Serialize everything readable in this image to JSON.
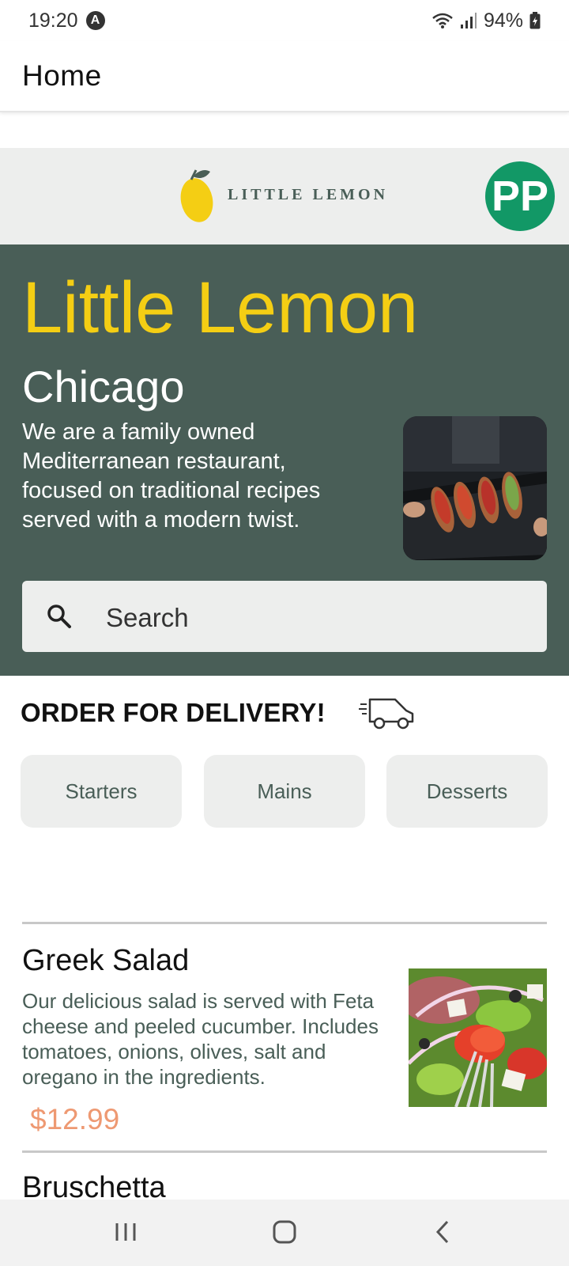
{
  "status_bar": {
    "time": "19:20",
    "app_badge": "A",
    "battery": "94%",
    "icons": [
      "wifi-icon",
      "signal-icon",
      "battery-icon"
    ]
  },
  "app_bar": {
    "title": "Home"
  },
  "brand": {
    "logo_text": "LITTLE LEMON",
    "avatar_initials": "PP",
    "colors": {
      "primary": "#495e57",
      "accent": "#f4ce14",
      "avatar": "#129866",
      "price": "#ee9972"
    }
  },
  "hero": {
    "title": "Little Lemon",
    "subtitle": "Chicago",
    "description": "We are a family owned Mediterranean restaurant, focused on traditional recipes served with a modern twist."
  },
  "search": {
    "placeholder": "Search"
  },
  "delivery": {
    "title": "ORDER FOR DELIVERY!",
    "categories": [
      "Starters",
      "Mains",
      "Desserts"
    ]
  },
  "menu": {
    "items": [
      {
        "name": "Greek Salad",
        "description": " Our delicious salad is served with Feta cheese and peeled cucumber. Includes tomatoes, onions, olives, salt and oregano in the ingredients.",
        "price": "$12.99"
      },
      {
        "name": "Bruschetta"
      }
    ]
  },
  "nav_bar": {
    "buttons": [
      "recent-apps-icon",
      "home-icon",
      "back-icon"
    ]
  }
}
